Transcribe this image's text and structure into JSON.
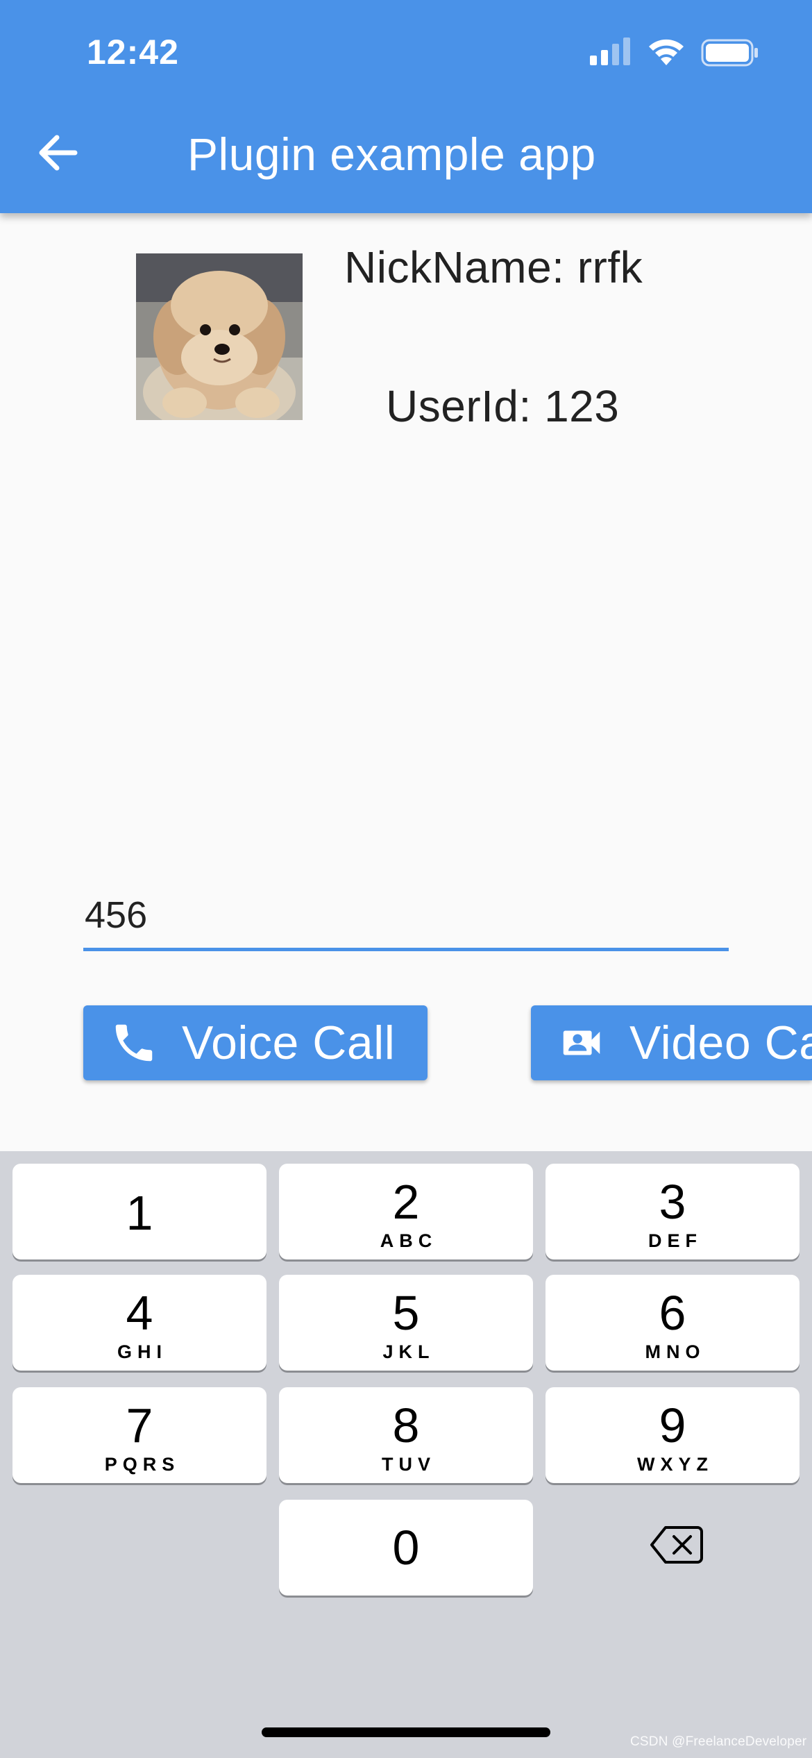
{
  "status_bar": {
    "time": "12:42"
  },
  "app_bar": {
    "title": "Plugin example app"
  },
  "profile": {
    "nickname": "NickName: rrfk",
    "userid": "UserId: 123"
  },
  "callee_input": {
    "value": "456"
  },
  "buttons": {
    "voice_call": "Voice Call",
    "video_call": "Video Call"
  },
  "keypad": {
    "keys": [
      {
        "digit": "1",
        "letters": ""
      },
      {
        "digit": "2",
        "letters": "ABC"
      },
      {
        "digit": "3",
        "letters": "DEF"
      },
      {
        "digit": "4",
        "letters": "GHI"
      },
      {
        "digit": "5",
        "letters": "JKL"
      },
      {
        "digit": "6",
        "letters": "MNO"
      },
      {
        "digit": "7",
        "letters": "PQRS"
      },
      {
        "digit": "8",
        "letters": "TUV"
      },
      {
        "digit": "9",
        "letters": "WXYZ"
      },
      {
        "digit": "0",
        "letters": ""
      }
    ]
  },
  "watermark": "CSDN @FreelanceDeveloper",
  "colors": {
    "accent": "#4a92e8",
    "keyboard_bg": "#d1d3d9",
    "background": "#fafafa"
  },
  "icons": [
    "back-arrow-icon",
    "signal-icon",
    "wifi-icon",
    "battery-icon",
    "phone-icon",
    "video-camera-icon",
    "backspace-icon"
  ]
}
